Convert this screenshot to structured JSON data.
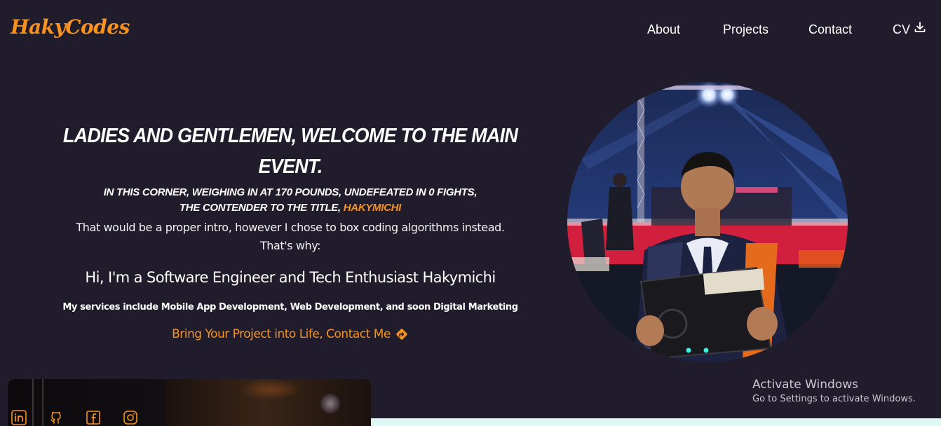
{
  "brand": {
    "logo": "HakyCodes",
    "color": "#f7921e"
  },
  "nav": {
    "items": [
      {
        "label": "About"
      },
      {
        "label": "Projects"
      },
      {
        "label": "Contact"
      },
      {
        "label": "CV",
        "icon": "download-icon"
      }
    ]
  },
  "hero": {
    "headline": "Ladies and Gentlemen, Welcome to the Main Event.",
    "sub_line1": "In this corner, weighing in at 170 pounds, undefeated in 0 fights,",
    "sub_line2_prefix": "the contender to the title, ",
    "sub_line2_name": "Hakymichi",
    "intro_line1": "That would be a proper intro, however I chose to box coding algorithms instead.",
    "intro_line2": "That's why:",
    "greeting": "Hi, I'm a Software Engineer and Tech Enthusiast Hakymichi",
    "services": "My services include Mobile App Development, Web Development, and soon Digital Marketing",
    "cta_label": "Bring Your Project into Life, Contact Me",
    "cta_icon": "directions-icon"
  },
  "socials": [
    {
      "icon": "linkedin-icon"
    },
    {
      "icon": "github-icon"
    },
    {
      "icon": "facebook-icon"
    },
    {
      "icon": "instagram-icon"
    }
  ],
  "watermark": {
    "title": "Activate Windows",
    "subtitle": "Go to Settings to activate Windows."
  }
}
